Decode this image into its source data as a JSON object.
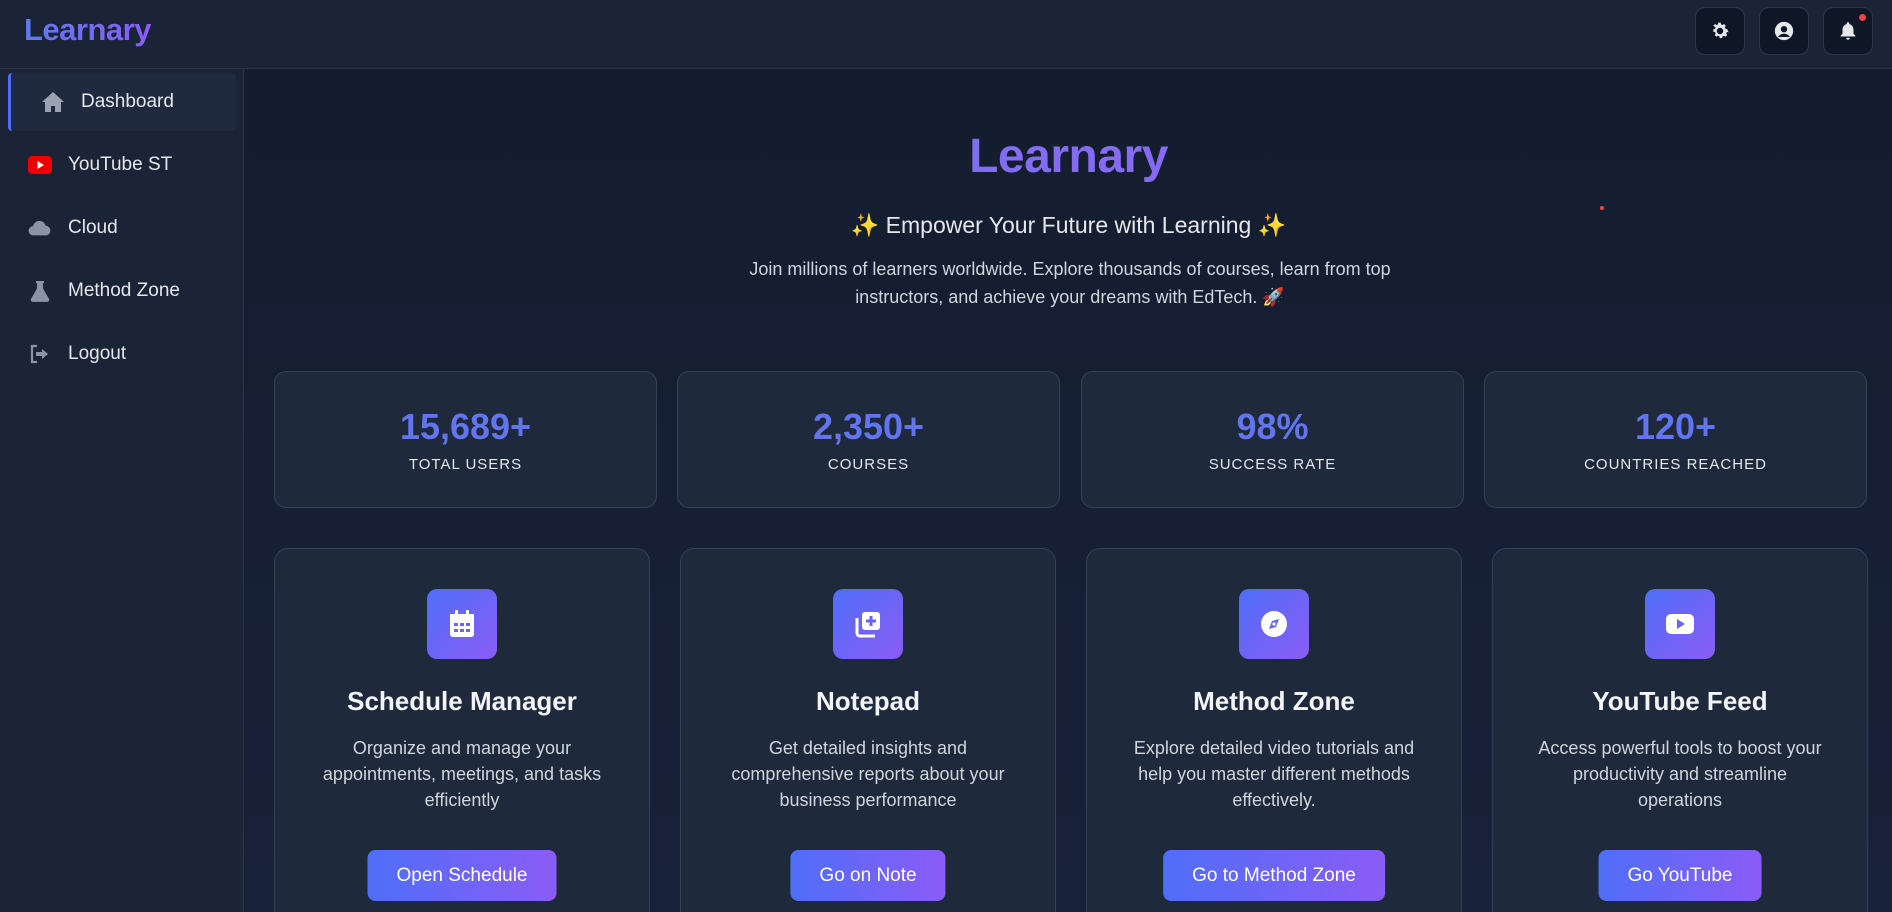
{
  "app": {
    "brand": "Learnary"
  },
  "topbar": {
    "icons": [
      "gear-icon",
      "user-circle-icon",
      "bell-icon"
    ]
  },
  "sidebar": {
    "items": [
      {
        "label": "Dashboard",
        "icon": "home-icon",
        "active": true
      },
      {
        "label": "YouTube ST",
        "icon": "youtube-icon"
      },
      {
        "label": "Cloud",
        "icon": "cloud-icon"
      },
      {
        "label": "Method Zone",
        "icon": "flask-icon"
      },
      {
        "label": "Logout",
        "icon": "logout-icon"
      }
    ]
  },
  "hero": {
    "title": "Learnary",
    "tagline": "✨ Empower Your Future with Learning ✨",
    "subtitle": "Join millions of learners worldwide. Explore thousands of courses, learn from top instructors, and achieve your dreams with EdTech. 🚀"
  },
  "stats": [
    {
      "value": "15,689+",
      "label": "TOTAL USERS"
    },
    {
      "value": "2,350+",
      "label": "COURSES"
    },
    {
      "value": "98%",
      "label": "SUCCESS RATE"
    },
    {
      "value": "120+",
      "label": "COUNTRIES REACHED"
    }
  ],
  "cards": [
    {
      "title": "Schedule Manager",
      "description": "Organize and manage your appointments, meetings, and tasks efficiently",
      "button": "Open Schedule",
      "icon": "calendar-icon"
    },
    {
      "title": "Notepad",
      "description": "Get detailed insights and comprehensive reports about your business performance",
      "button": "Go on Note",
      "icon": "note-add-icon"
    },
    {
      "title": "Method Zone",
      "description": "Explore detailed video tutorials and help you master different methods effectively.",
      "button": "Go to Method Zone",
      "icon": "compass-icon"
    },
    {
      "title": "YouTube Feed",
      "description": "Access powerful tools to boost your productivity and streamline operations",
      "button": "Go YouTube",
      "icon": "video-play-icon"
    }
  ],
  "colors": {
    "accent": "#4f6ef7",
    "accent2": "#8b5cf6",
    "youtube": "#ef0000",
    "background": "#172033"
  }
}
